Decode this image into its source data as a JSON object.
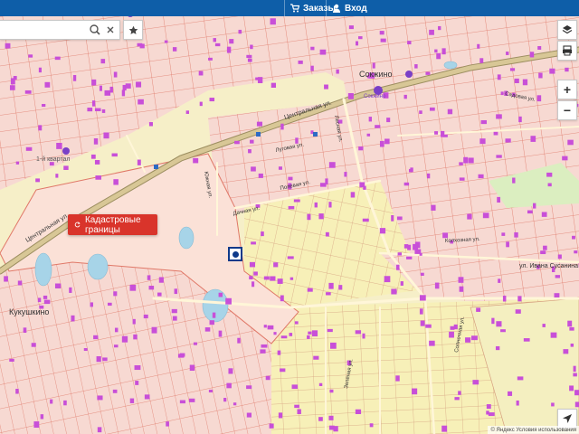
{
  "topbar": {
    "orders_label": "Заказы",
    "login_label": "Вход"
  },
  "search": {
    "value": ""
  },
  "map": {
    "place_labels": [
      "Сокжино",
      "Кукушкино",
      "1-й квартал",
      "Сокжино"
    ],
    "street_labels": [
      "Центральная ул.",
      "Центральная ул.",
      "Лесная ул.",
      "Луговая ул.",
      "Полевая ул.",
      "Южная ул.",
      "Дачная ул.",
      "Колхозная ул.",
      "ул. Ивана Сусанина",
      "Солнечная ул.",
      "Зелёная ул.",
      "Садовая ул."
    ],
    "cadastral_button_label": "Кадастровые границы",
    "copyright": "© Яндекс  Условия использования"
  },
  "controls": {
    "zoom_in": "+",
    "zoom_out": "−"
  },
  "colors": {
    "topbar": "#0e5ea8",
    "parcel_fill": "#f6efc8",
    "parcel_border": "#e07060",
    "building": "#c84fd8",
    "road": "#b3a57a",
    "cadastral_button": "#d9342b"
  }
}
